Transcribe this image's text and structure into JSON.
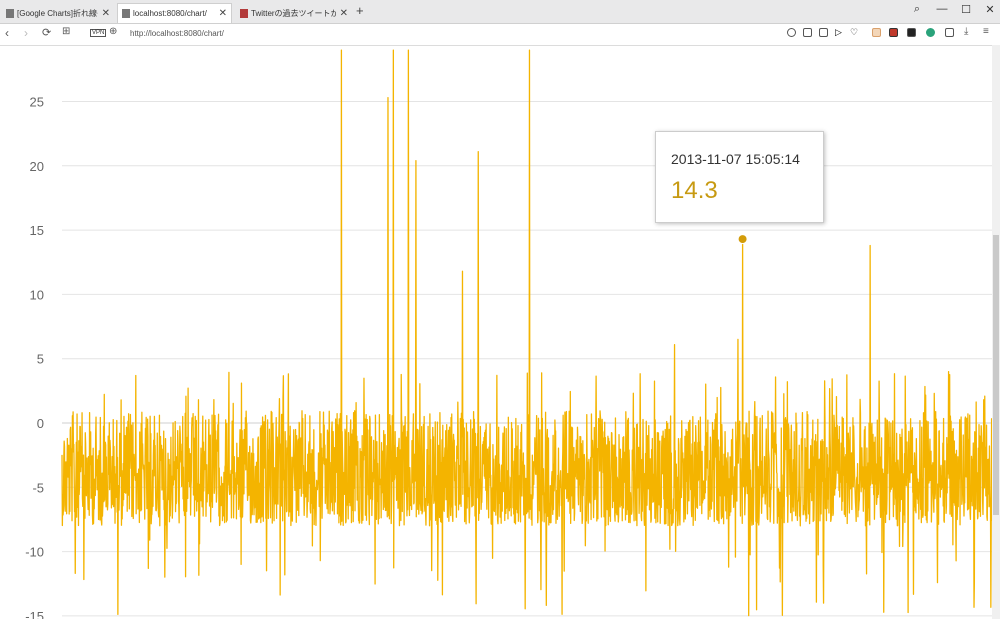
{
  "browser": {
    "tabs": [
      {
        "label": "[Google Charts]折れ線グラフ"
      },
      {
        "label": "localhost:8080/chart/"
      },
      {
        "label": "Twitterの過去ツイートからベスト"
      }
    ],
    "new_tab": "+",
    "url": "http://localhost:8080/chart/",
    "vpn_label": "VPN",
    "window_controls": {
      "minimize": "—",
      "maximize": "☐",
      "close": "✕"
    }
  },
  "chart_data": {
    "type": "line",
    "color": "#f4b400",
    "y_ticks": [
      "25",
      "20",
      "15",
      "10",
      "5",
      "0",
      "-5",
      "-10",
      "-15"
    ],
    "grid": true,
    "highlight": {
      "x": "2013-11-07 15:05:14",
      "y": 14.3
    },
    "spikes": [
      {
        "pos": 0.3,
        "y": 29
      },
      {
        "pos": 0.35,
        "y": 25.3
      },
      {
        "pos": 0.356,
        "y": 29
      },
      {
        "pos": 0.372,
        "y": 29
      },
      {
        "pos": 0.38,
        "y": 20.4
      },
      {
        "pos": 0.43,
        "y": 11.8
      },
      {
        "pos": 0.447,
        "y": 21.1
      },
      {
        "pos": 0.502,
        "y": 29
      },
      {
        "pos": 0.658,
        "y": 6.1
      },
      {
        "pos": 0.726,
        "y": 6.5
      },
      {
        "pos": 0.731,
        "y": 14.3
      },
      {
        "pos": 0.868,
        "y": 13.8
      }
    ]
  },
  "tooltip": {
    "date": "2013-11-07 15:05:14",
    "value": "14.3"
  }
}
